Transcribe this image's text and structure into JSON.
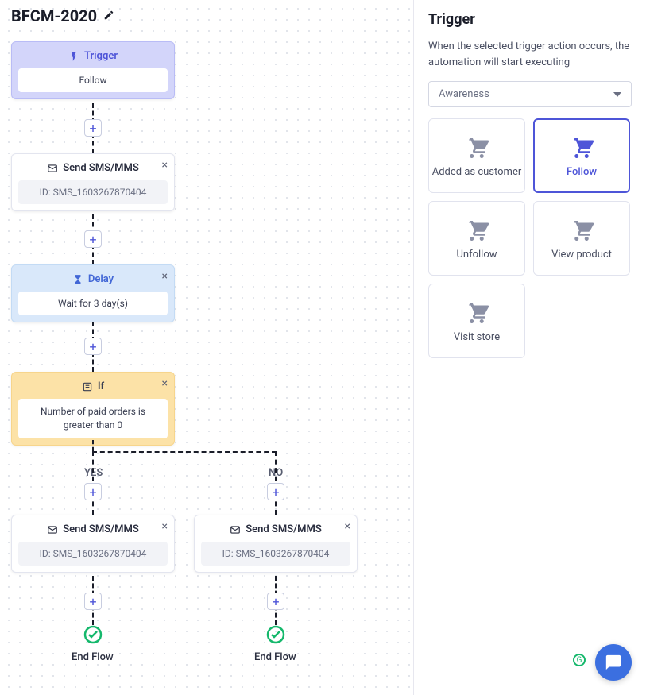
{
  "title": "BFCM-2020",
  "nodes": {
    "trigger": {
      "label": "Trigger",
      "value": "Follow"
    },
    "sms1": {
      "label": "Send SMS/MMS",
      "value": "ID: SMS_1603267870404"
    },
    "delay": {
      "label": "Delay",
      "value": "Wait for 3 day(s)"
    },
    "ifnode": {
      "label": "If",
      "value": "Number of paid orders is greater than 0"
    },
    "smsYes": {
      "label": "Send SMS/MMS",
      "value": "ID: SMS_1603267870404"
    },
    "smsNo": {
      "label": "Send SMS/MMS",
      "value": "ID: SMS_1603267870404"
    },
    "endYes": "End Flow",
    "endNo": "End Flow"
  },
  "branches": {
    "yes": "YES",
    "no": "NO"
  },
  "panel": {
    "heading": "Trigger",
    "description": "When the selected trigger action occurs, the automation will start executing",
    "dropdown": "Awareness",
    "tiles": {
      "added": "Added as customer",
      "follow": "Follow",
      "unfollow": "Unfollow",
      "viewProduct": "View product",
      "visitStore": "Visit store"
    }
  }
}
